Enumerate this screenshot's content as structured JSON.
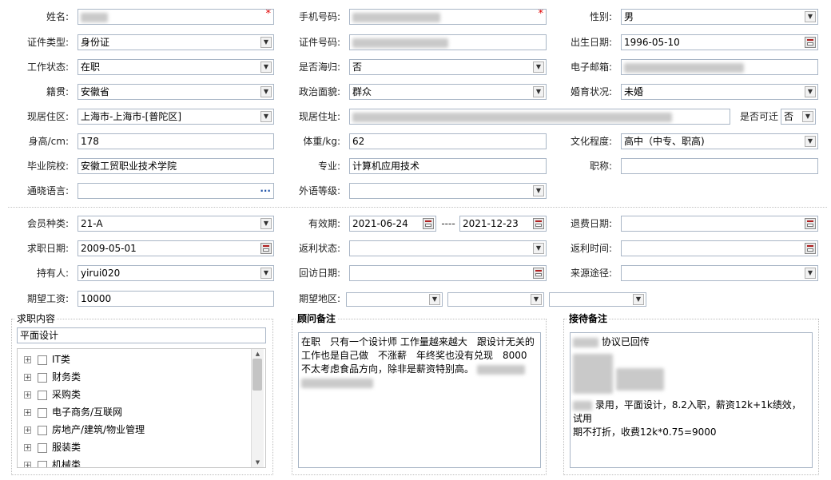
{
  "form": {
    "name_label": "姓名:",
    "phone_label": "手机号码:",
    "gender_label": "性别:",
    "gender_value": "男",
    "id_type_label": "证件类型:",
    "id_type_value": "身份证",
    "id_number_label": "证件号码:",
    "birth_label": "出生日期:",
    "birth_value": "1996-05-10",
    "work_status_label": "工作状态:",
    "work_status_value": "在职",
    "overseas_label": "是否海归:",
    "overseas_value": "否",
    "email_label": "电子邮箱:",
    "origin_label": "籍贯:",
    "origin_value": "安徽省",
    "political_label": "政治面貌:",
    "political_value": "群众",
    "marital_label": "婚育状况:",
    "marital_value": "未婚",
    "residence_area_label": "现居住区:",
    "residence_area_value": "上海市-上海市-[普陀区]",
    "residence_addr_label": "现居住址:",
    "relocate_label": "是否可迁",
    "relocate_value": "否",
    "height_label": "身高/cm:",
    "height_value": "178",
    "weight_label": "体重/kg:",
    "weight_value": "62",
    "education_label": "文化程度:",
    "education_value": "高中（中专、职高)",
    "school_label": "毕业院校:",
    "school_value": "安徽工贸职业技术学院",
    "major_label": "专业:",
    "major_value": "计算机应用技术",
    "title_label": "职称:",
    "language_label": "通晓语言:",
    "language_btn": "···",
    "foreign_level_label": "外语等级:"
  },
  "membership": {
    "type_label": "会员种类:",
    "type_value": "21-A",
    "valid_label": "有效期:",
    "valid_from": "2021-06-24",
    "valid_sep": "----",
    "valid_to": "2021-12-23",
    "refund_date_label": "退费日期:",
    "job_date_label": "求职日期:",
    "job_date_value": "2009-05-01",
    "rebate_status_label": "返利状态:",
    "rebate_time_label": "返利时间:",
    "holder_label": "持有人:",
    "holder_value": "yirui020",
    "revisit_label": "回访日期:",
    "source_label": "来源途径:",
    "salary_label": "期望工资:",
    "salary_value": "10000",
    "region_label": "期望地区:"
  },
  "job_content": {
    "title": "求职内容",
    "selected": "平面设计",
    "categories": [
      {
        "label": "IT类"
      },
      {
        "label": "财务类"
      },
      {
        "label": "采购类"
      },
      {
        "label": "电子商务/互联网"
      },
      {
        "label": "房地产/建筑/物业管理"
      },
      {
        "label": "服装类"
      },
      {
        "label": "机械类"
      }
    ]
  },
  "consultant_notes": {
    "title": "顾问备注",
    "line1": "在职　只有一个设计师 工作量越来越大　跟设计无关的",
    "line2": "工作也是自己做　不涨薪　年终奖也没有兑现　8000",
    "line3": "不太考虑食品方向，除非是薪资特别高。"
  },
  "reception_notes": {
    "title": "接待备注",
    "line1": "协议已回传",
    "line2": "录用，平面设计，8.2入职，薪资12k+1k绩效，试用",
    "line3": "期不打折，收费12k*0.75=9000"
  }
}
